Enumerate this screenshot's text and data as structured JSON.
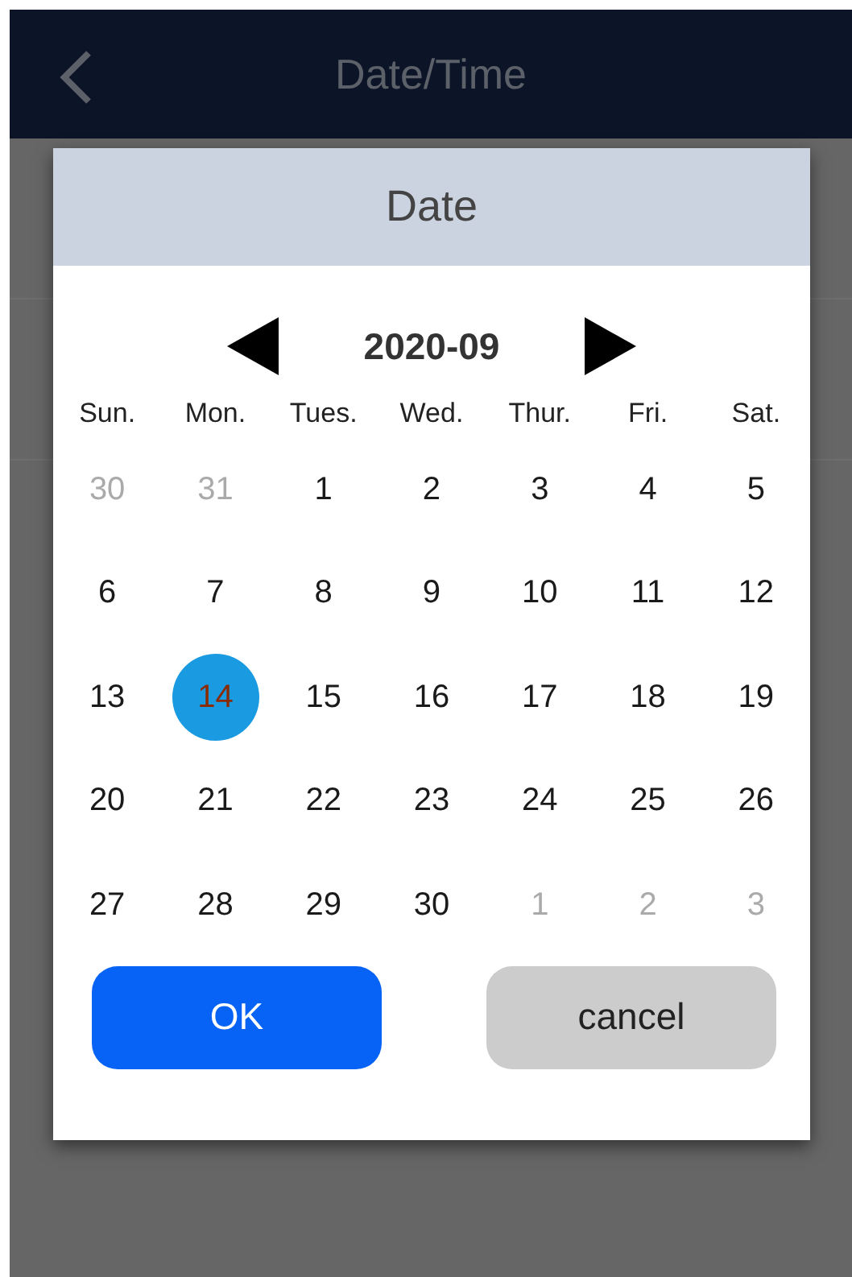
{
  "app_bar": {
    "title": "Date/Time"
  },
  "dialog": {
    "title": "Date",
    "month": "2020-09",
    "weekdays": [
      "Sun.",
      "Mon.",
      "Tues.",
      "Wed.",
      "Thur.",
      "Fri.",
      "Sat."
    ],
    "weeks": [
      [
        {
          "label": "30",
          "outside_month": true,
          "selected": false
        },
        {
          "label": "31",
          "outside_month": true,
          "selected": false
        },
        {
          "label": "1",
          "outside_month": false,
          "selected": false
        },
        {
          "label": "2",
          "outside_month": false,
          "selected": false
        },
        {
          "label": "3",
          "outside_month": false,
          "selected": false
        },
        {
          "label": "4",
          "outside_month": false,
          "selected": false
        },
        {
          "label": "5",
          "outside_month": false,
          "selected": false
        }
      ],
      [
        {
          "label": "6",
          "outside_month": false,
          "selected": false
        },
        {
          "label": "7",
          "outside_month": false,
          "selected": false
        },
        {
          "label": "8",
          "outside_month": false,
          "selected": false
        },
        {
          "label": "9",
          "outside_month": false,
          "selected": false
        },
        {
          "label": "10",
          "outside_month": false,
          "selected": false
        },
        {
          "label": "11",
          "outside_month": false,
          "selected": false
        },
        {
          "label": "12",
          "outside_month": false,
          "selected": false
        }
      ],
      [
        {
          "label": "13",
          "outside_month": false,
          "selected": false
        },
        {
          "label": "14",
          "outside_month": false,
          "selected": true
        },
        {
          "label": "15",
          "outside_month": false,
          "selected": false
        },
        {
          "label": "16",
          "outside_month": false,
          "selected": false
        },
        {
          "label": "17",
          "outside_month": false,
          "selected": false
        },
        {
          "label": "18",
          "outside_month": false,
          "selected": false
        },
        {
          "label": "19",
          "outside_month": false,
          "selected": false
        }
      ],
      [
        {
          "label": "20",
          "outside_month": false,
          "selected": false
        },
        {
          "label": "21",
          "outside_month": false,
          "selected": false
        },
        {
          "label": "22",
          "outside_month": false,
          "selected": false
        },
        {
          "label": "23",
          "outside_month": false,
          "selected": false
        },
        {
          "label": "24",
          "outside_month": false,
          "selected": false
        },
        {
          "label": "25",
          "outside_month": false,
          "selected": false
        },
        {
          "label": "26",
          "outside_month": false,
          "selected": false
        }
      ],
      [
        {
          "label": "27",
          "outside_month": false,
          "selected": false
        },
        {
          "label": "28",
          "outside_month": false,
          "selected": false
        },
        {
          "label": "29",
          "outside_month": false,
          "selected": false
        },
        {
          "label": "30",
          "outside_month": false,
          "selected": false
        },
        {
          "label": "1",
          "outside_month": true,
          "selected": false
        },
        {
          "label": "2",
          "outside_month": true,
          "selected": false
        },
        {
          "label": "3",
          "outside_month": true,
          "selected": false
        }
      ]
    ],
    "buttons": [
      {
        "label": "OK",
        "kind": "primary"
      },
      {
        "label": "cancel",
        "kind": "secondary"
      }
    ]
  }
}
